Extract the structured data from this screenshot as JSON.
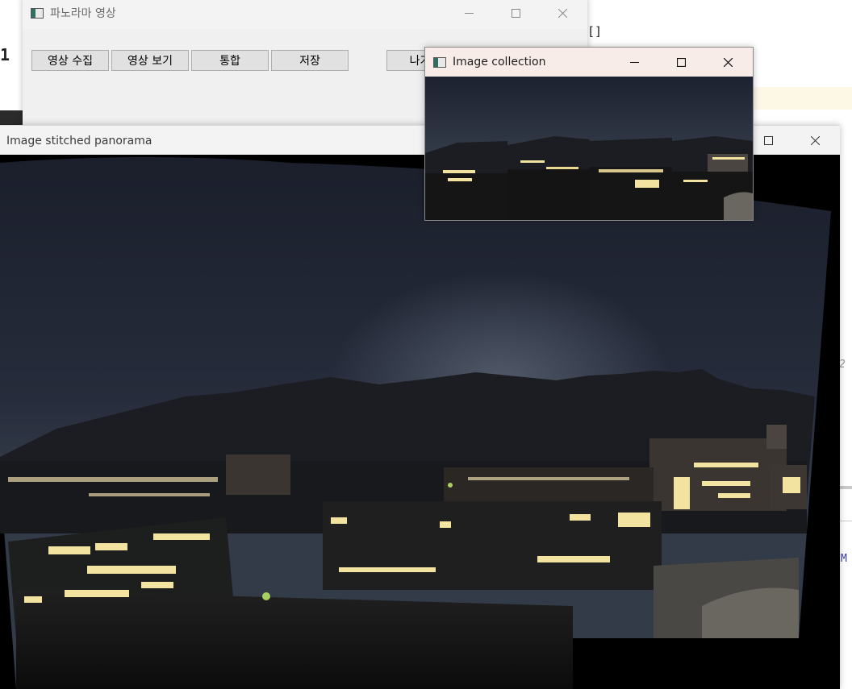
{
  "background": {
    "line_number": "1",
    "brackets": "[]",
    "italic_number": "2",
    "mono_fragment": "M"
  },
  "main_window": {
    "title": "파노라마 영상",
    "icon": "app-window-icon",
    "buttons": [
      "영상 수집",
      "영상 보기",
      "통합",
      "저장"
    ],
    "exit_label": "나가기"
  },
  "panorama_window": {
    "title": "Image stitched panorama",
    "icon": "app-window-icon"
  },
  "collection_window": {
    "title": "Image collection",
    "icon": "app-window-icon",
    "image_count": 4
  },
  "colors": {
    "sky_top": "#1c2030",
    "sky_mid": "#2c3243",
    "mountain": "#1e1e22",
    "light": "#f5e6a0"
  }
}
